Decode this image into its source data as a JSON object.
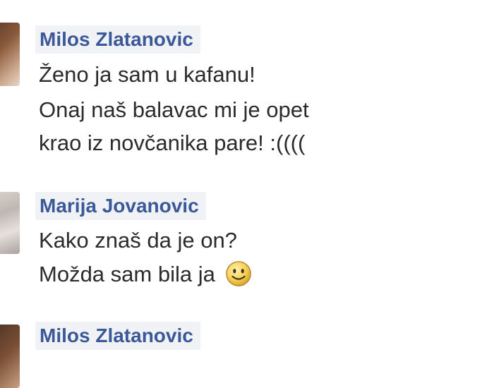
{
  "messages": [
    {
      "author": "Milos Zlatanovic",
      "lines": [
        "Ženo ja sam u kafanu!",
        "Onaj naš balavac mi je opet",
        "krao iz novčanika pare! :(((("
      ]
    },
    {
      "author": "Marija Jovanovic",
      "lines": [
        "Kako znaš da je on?",
        "Možda sam bila ja"
      ],
      "emoji": "smiley-emoji"
    },
    {
      "author": "Milos Zlatanovic",
      "lines": []
    }
  ]
}
